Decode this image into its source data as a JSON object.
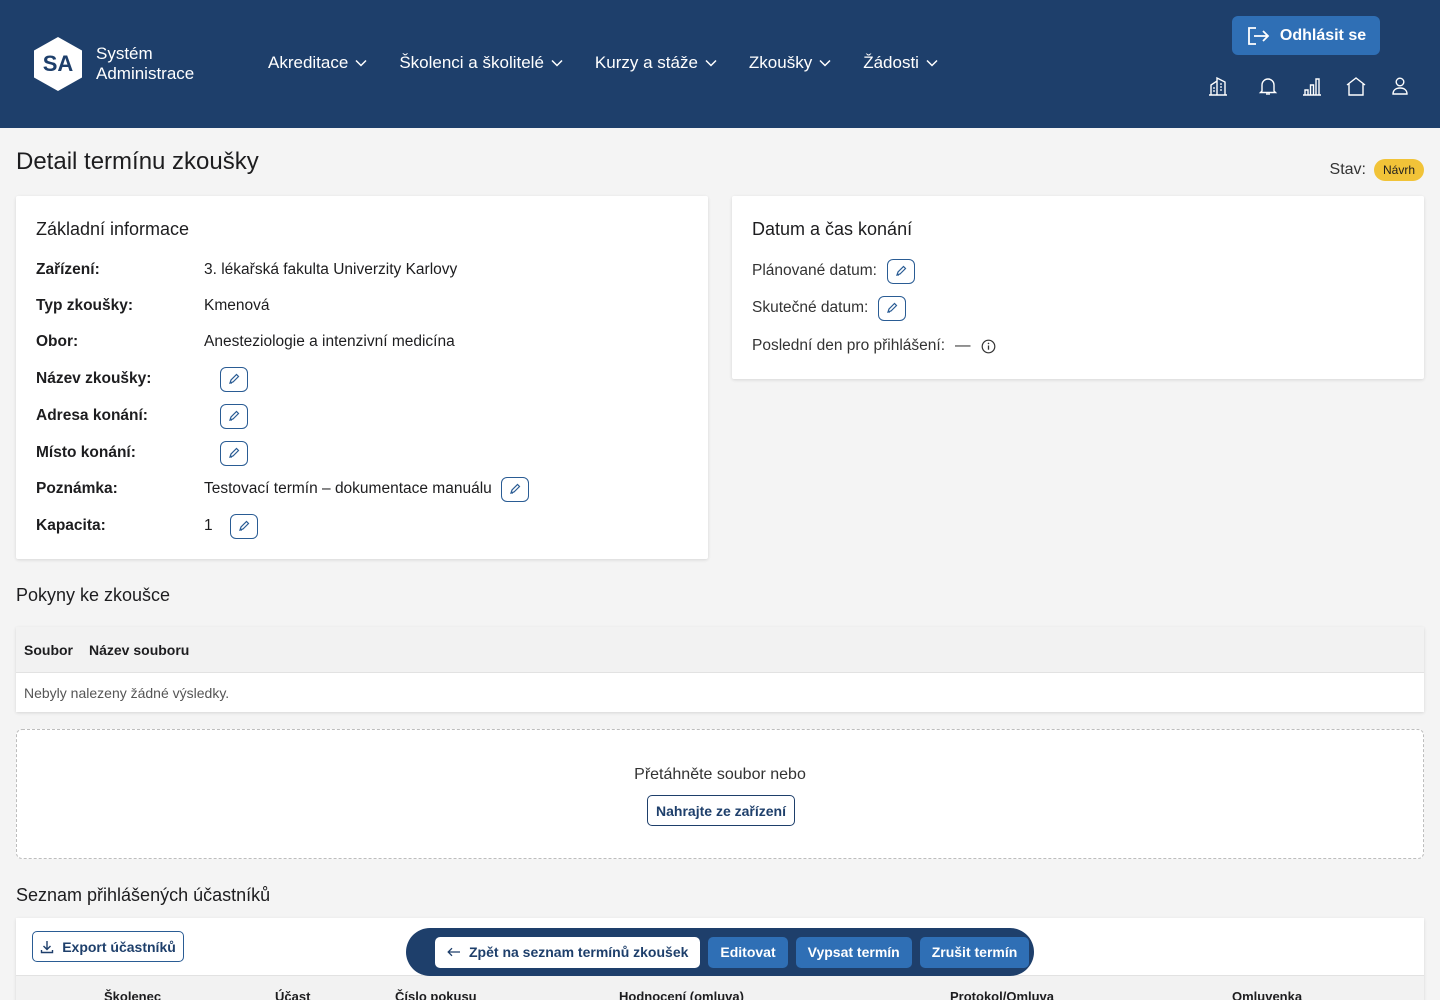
{
  "header": {
    "logo_initials": "SA",
    "logo_line1": "Systém",
    "logo_line2": "Administrace",
    "nav": [
      {
        "label": "Akreditace"
      },
      {
        "label": "Školenci a školitelé"
      },
      {
        "label": "Kurzy a stáže"
      },
      {
        "label": "Zkoušky"
      },
      {
        "label": "Žádosti"
      }
    ],
    "logout_label": "Odhlásit se",
    "icons": [
      "building-icon",
      "bell-icon",
      "chart-icon",
      "home-icon",
      "user-icon"
    ]
  },
  "page": {
    "title": "Detail termínu zkoušky",
    "status_label": "Stav:",
    "status_value": "Návrh"
  },
  "basic_info": {
    "title": "Základní informace",
    "rows": [
      {
        "label": "Zařízení:",
        "value": "3. lékařská fakulta Univerzity Karlovy"
      },
      {
        "label": "Typ zkoušky:",
        "value": "Kmenová"
      },
      {
        "label": "Obor:",
        "value": "Anesteziologie a intenzivní medicína"
      },
      {
        "label": "Název zkoušky:",
        "value": ""
      },
      {
        "label": "Adresa konání:",
        "value": ""
      },
      {
        "label": "Místo konání:",
        "value": ""
      },
      {
        "label": "Poznámka:",
        "value": "Testovací termín – dokumentace manuálu"
      },
      {
        "label": "Kapacita:",
        "value": "1"
      }
    ]
  },
  "datetime": {
    "title": "Datum a čas konání",
    "planned_label": "Plánované datum:",
    "actual_label": "Skutečné datum:",
    "last_day_label": "Poslední den pro přihlášení:",
    "last_day_value": "—"
  },
  "instructions": {
    "title": "Pokyny ke zkoušce",
    "columns": [
      "Soubor",
      "Název souboru"
    ],
    "empty_text": "Nebyly nalezeny žádné výsledky."
  },
  "dropzone": {
    "text": "Přetáhněte soubor nebo",
    "button": "Nahrajte ze zařízení"
  },
  "participants": {
    "title": "Seznam přihlášených účastníků",
    "export_label": "Export účastníků",
    "columns": [
      "Školenec",
      "Účast",
      "Číslo pokusu",
      "Hodnocení (omluva)",
      "Protokol/Omluva",
      "Omluvenka"
    ]
  },
  "actions": {
    "back_label": "Zpět na seznam termínů zkoušek",
    "edit_label": "Editovat",
    "publish_label": "Vypsat termín",
    "cancel_label": "Zrušit termín"
  },
  "colors": {
    "header_bg": "#1e3f6b",
    "primary": "#2f6fb5",
    "badge": "#f1c338"
  }
}
